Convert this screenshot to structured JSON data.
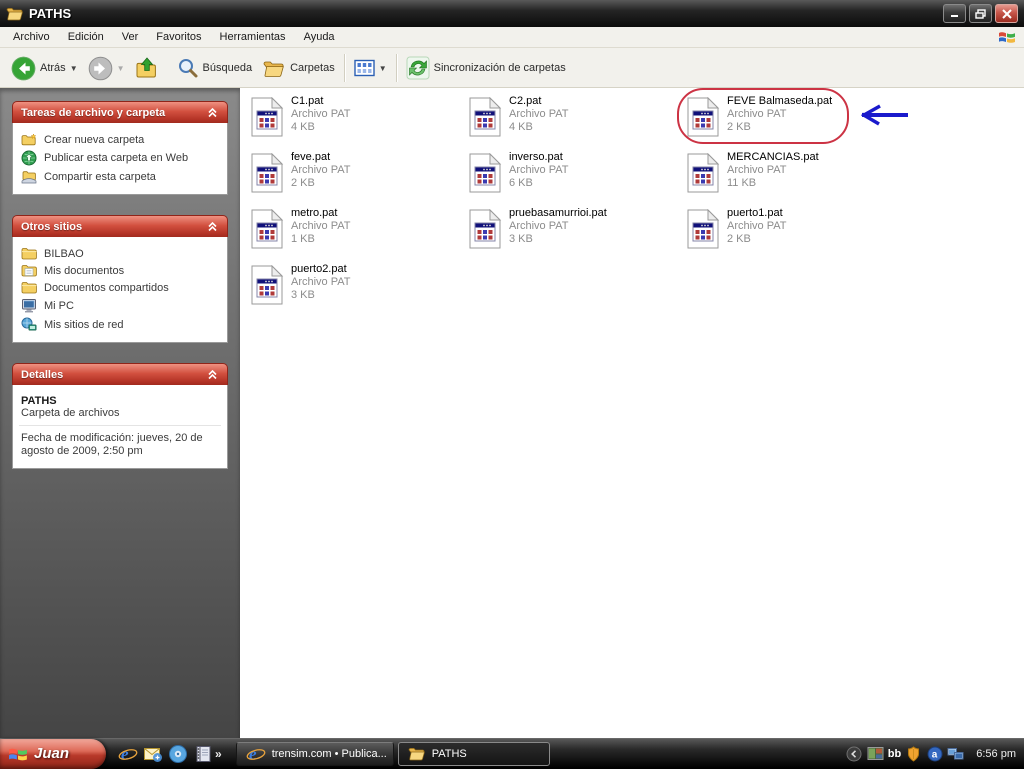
{
  "window": {
    "title": "PATHS",
    "controls": {
      "minimize": "minimize",
      "restore": "restore",
      "close": "close"
    }
  },
  "menu": {
    "items": [
      "Archivo",
      "Edición",
      "Ver",
      "Favoritos",
      "Herramientas",
      "Ayuda"
    ]
  },
  "toolbar": {
    "back_label": "Atrás",
    "search_label": "Búsqueda",
    "folders_label": "Carpetas",
    "sync_label": "Sincronización de carpetas"
  },
  "sidebar": {
    "panels": [
      {
        "title": "Tareas de archivo y carpeta",
        "items": [
          {
            "icon": "new-folder-icon",
            "label": "Crear nueva carpeta"
          },
          {
            "icon": "web-publish-icon",
            "label": "Publicar esta carpeta en Web"
          },
          {
            "icon": "share-folder-icon",
            "label": "Compartir esta carpeta"
          }
        ]
      },
      {
        "title": "Otros sitios",
        "items": [
          {
            "icon": "folder-icon",
            "label": "BILBAO"
          },
          {
            "icon": "my-documents-icon",
            "label": "Mis documentos"
          },
          {
            "icon": "folder-icon",
            "label": "Documentos compartidos"
          },
          {
            "icon": "my-computer-icon",
            "label": "Mi PC"
          },
          {
            "icon": "network-places-icon",
            "label": "Mis sitios de red"
          }
        ]
      },
      {
        "title": "Detalles",
        "details": {
          "name": "PATHS",
          "type": "Carpeta de archivos",
          "modified": "Fecha de modificación: jueves, 20 de agosto de 2009, 2:50 pm"
        }
      }
    ]
  },
  "files": [
    {
      "name": "C1.pat",
      "type": "Archivo PAT",
      "size": "4 KB"
    },
    {
      "name": "C2.pat",
      "type": "Archivo PAT",
      "size": "4 KB"
    },
    {
      "name": "FEVE Balmaseda.pat",
      "type": "Archivo PAT",
      "size": "2 KB"
    },
    {
      "name": "feve.pat",
      "type": "Archivo PAT",
      "size": "2 KB"
    },
    {
      "name": "inverso.pat",
      "type": "Archivo PAT",
      "size": "6 KB"
    },
    {
      "name": "MERCANCIAS.pat",
      "type": "Archivo PAT",
      "size": "11 KB"
    },
    {
      "name": "metro.pat",
      "type": "Archivo PAT",
      "size": "1 KB"
    },
    {
      "name": "pruebasamurrioi.pat",
      "type": "Archivo PAT",
      "size": "3 KB"
    },
    {
      "name": "puerto1.pat",
      "type": "Archivo PAT",
      "size": "2 KB"
    },
    {
      "name": "puerto2.pat",
      "type": "Archivo PAT",
      "size": "3 KB"
    }
  ],
  "annotation": {
    "highlighted_file": "FEVE Balmaseda.pat",
    "ellipse_color": "#cc3344",
    "arrow_color": "#1a1acc"
  },
  "taskbar": {
    "start_label": "Juan",
    "quick_launch_icons": [
      "ie-icon",
      "outlook-express-icon",
      "media-disc-icon",
      "address-book-icon"
    ],
    "overflow": "»",
    "buttons": [
      {
        "icon": "ie-icon",
        "label": "trensim.com • Publica...",
        "active": false
      },
      {
        "icon": "folder-open-icon",
        "label": "PATHS",
        "active": true
      }
    ],
    "tray": {
      "icons": [
        "collapse-chevron-icon",
        "picture-icon",
        "bb-badge",
        "security-shield-icon",
        "a-badge-icon",
        "network-icon"
      ],
      "bb_label": "bb",
      "time": "6:56 pm"
    }
  },
  "colors": {
    "panel_header_red": "#c23b2e",
    "titlebar": "#1e1e1e",
    "taskbar": "#141414",
    "file_meta_gray": "#8c8c8c"
  }
}
